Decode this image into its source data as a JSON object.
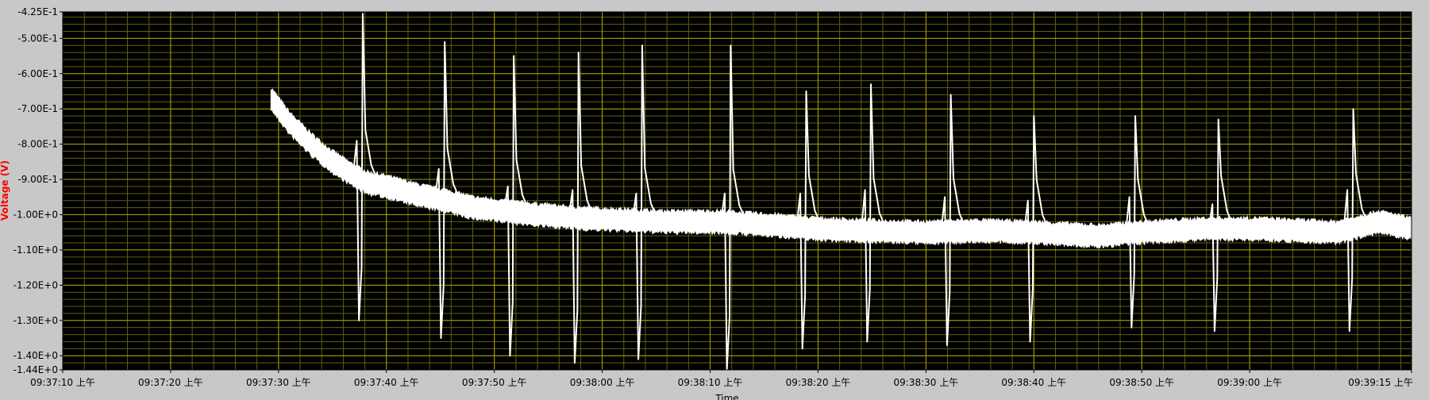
{
  "colors": {
    "frame": "#c8c8c8",
    "plot_bg": "#000000",
    "major_grid": "#a8a000",
    "minor_grid": "#5f5f10",
    "trace": "#ffffff",
    "ylabel": "#ff0000",
    "xlabel": "#000000"
  },
  "chart_data": {
    "type": "line",
    "xlabel": "Time",
    "ylabel": "Voltage (V)",
    "xlim": [
      0,
      125
    ],
    "ylim": [
      -1.44,
      -0.425
    ],
    "grid": true,
    "x_ticks": [
      {
        "t": 0,
        "label": "09:37:10 上午"
      },
      {
        "t": 10,
        "label": "09:37:20 上午"
      },
      {
        "t": 20,
        "label": "09:37:30 上午"
      },
      {
        "t": 30,
        "label": "09:37:40 上午"
      },
      {
        "t": 40,
        "label": "09:37:50 上午"
      },
      {
        "t": 50,
        "label": "09:38:00 上午"
      },
      {
        "t": 60,
        "label": "09:38:10 上午"
      },
      {
        "t": 70,
        "label": "09:38:20 上午"
      },
      {
        "t": 80,
        "label": "09:38:30 上午"
      },
      {
        "t": 90,
        "label": "09:38:40 上午"
      },
      {
        "t": 100,
        "label": "09:38:50 上午"
      },
      {
        "t": 110,
        "label": "09:39:00 上午"
      },
      {
        "t": 125,
        "label": "09:39:15 上午"
      }
    ],
    "y_ticks": [
      {
        "v": -0.425,
        "label": "-4.25E-1"
      },
      {
        "v": -0.5,
        "label": "-5.00E-1"
      },
      {
        "v": -0.6,
        "label": "-6.00E-1"
      },
      {
        "v": -0.7,
        "label": "-7.00E-1"
      },
      {
        "v": -0.8,
        "label": "-8.00E-1"
      },
      {
        "v": -0.9,
        "label": "-9.00E-1"
      },
      {
        "v": -1.0,
        "label": "-1.00E+0"
      },
      {
        "v": -1.1,
        "label": "-1.10E+0"
      },
      {
        "v": -1.2,
        "label": "-1.20E+0"
      },
      {
        "v": -1.3,
        "label": "-1.30E+0"
      },
      {
        "v": -1.4,
        "label": "-1.40E+0"
      },
      {
        "v": -1.44,
        "label": "-1.44E+0"
      }
    ],
    "series": [
      {
        "baseline": [
          {
            "t": 19.3,
            "v": -0.67
          },
          {
            "t": 21,
            "v": -0.74
          },
          {
            "t": 23,
            "v": -0.8
          },
          {
            "t": 25,
            "v": -0.85
          },
          {
            "t": 27,
            "v": -0.89
          },
          {
            "t": 28.3,
            "v": -0.91
          },
          {
            "t": 30,
            "v": -0.92
          },
          {
            "t": 33,
            "v": -0.945
          },
          {
            "t": 35.5,
            "v": -0.96
          },
          {
            "t": 38,
            "v": -0.98
          },
          {
            "t": 41,
            "v": -0.99
          },
          {
            "t": 44,
            "v": -1.0
          },
          {
            "t": 48,
            "v": -1.01
          },
          {
            "t": 52,
            "v": -1.015
          },
          {
            "t": 56,
            "v": -1.02
          },
          {
            "t": 61,
            "v": -1.02
          },
          {
            "t": 66,
            "v": -1.03
          },
          {
            "t": 70,
            "v": -1.04
          },
          {
            "t": 74,
            "v": -1.045
          },
          {
            "t": 80,
            "v": -1.05
          },
          {
            "t": 85,
            "v": -1.045
          },
          {
            "t": 90,
            "v": -1.05
          },
          {
            "t": 96,
            "v": -1.06
          },
          {
            "t": 100,
            "v": -1.05
          },
          {
            "t": 106,
            "v": -1.04
          },
          {
            "t": 111,
            "v": -1.04
          },
          {
            "t": 118,
            "v": -1.05
          },
          {
            "t": 122,
            "v": -1.02
          },
          {
            "t": 125,
            "v": -1.04
          }
        ],
        "band_width": 0.06,
        "spikes": [
          {
            "t": 27.8,
            "max": -0.43,
            "min": -1.3,
            "pre": -0.79
          },
          {
            "t": 35.4,
            "max": -0.51,
            "min": -1.35,
            "pre": -0.87
          },
          {
            "t": 41.8,
            "max": -0.55,
            "min": -1.4,
            "pre": -0.92
          },
          {
            "t": 47.8,
            "max": -0.54,
            "min": -1.42,
            "pre": -0.93
          },
          {
            "t": 53.7,
            "max": -0.52,
            "min": -1.41,
            "pre": -0.94
          },
          {
            "t": 61.9,
            "max": -0.52,
            "min": -1.44,
            "pre": -0.94
          },
          {
            "t": 68.9,
            "max": -0.65,
            "min": -1.38,
            "pre": -0.94
          },
          {
            "t": 74.9,
            "max": -0.63,
            "min": -1.36,
            "pre": -0.93
          },
          {
            "t": 82.3,
            "max": -0.66,
            "min": -1.37,
            "pre": -0.95
          },
          {
            "t": 90.0,
            "max": -0.72,
            "min": -1.36,
            "pre": -0.96
          },
          {
            "t": 99.4,
            "max": -0.72,
            "min": -1.32,
            "pre": -0.95
          },
          {
            "t": 107.1,
            "max": -0.73,
            "min": -1.33,
            "pre": -0.97
          },
          {
            "t": 119.6,
            "max": -0.7,
            "min": -1.33,
            "pre": -0.93
          }
        ]
      }
    ]
  }
}
